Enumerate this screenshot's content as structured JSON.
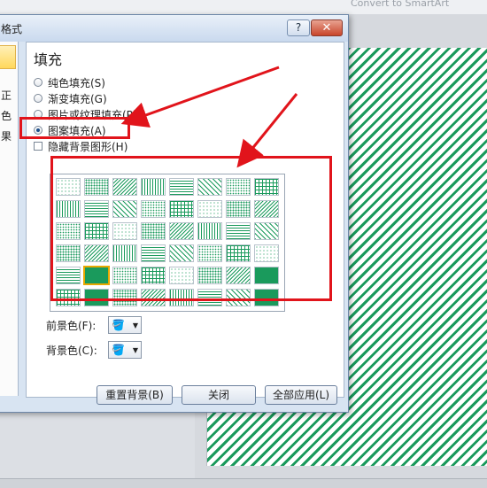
{
  "background": {
    "top_text": "Convert to SmartArt",
    "slide_pattern_color": "#1a9a5c"
  },
  "dialog": {
    "title": "格式",
    "help_label": "?",
    "close_label": "✕",
    "left_items": [
      "正",
      "色",
      "果"
    ],
    "section_title": "填充",
    "options": [
      {
        "label": "纯色填充(S)",
        "selected": false
      },
      {
        "label": "渐变填充(G)",
        "selected": false
      },
      {
        "label": "图片或纹理填充(P)",
        "selected": false
      },
      {
        "label": "图案填充(A)",
        "selected": true
      }
    ],
    "hide_bg_label": "隐藏背景图形(H)",
    "foreground_label": "前景色(F):",
    "background_label": "背景色(C):",
    "foreground_color": "#1a9a5c",
    "background_color": "#ffffff",
    "pattern_selected_index": 33,
    "buttons": {
      "reset": "重置背景(B)",
      "close": "关闭",
      "apply_all": "全部应用(L)"
    }
  },
  "annotation_color": "#e1141b"
}
